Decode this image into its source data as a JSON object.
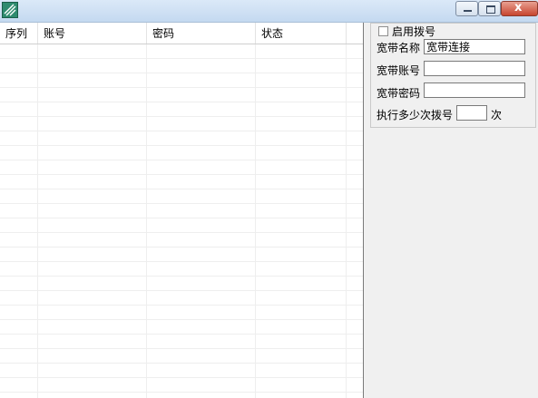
{
  "window": {
    "title": "",
    "icon": "app-logo-icon",
    "buttons": [
      "minimize-icon",
      "maximize-icon",
      "close-icon"
    ],
    "close_glyph": "x"
  },
  "grid": {
    "columns": [
      "序列",
      "账号",
      "密码",
      "状态"
    ],
    "rows": []
  },
  "settings": {
    "enable_dial_label": "启用拨号",
    "enable_dial_checked": false,
    "broadband_name_label": "宽带名称",
    "broadband_name_value": "宽带连接",
    "broadband_account_label": "宽带账号",
    "broadband_account_value": "",
    "broadband_password_label": "宽带密码",
    "broadband_password_value": "",
    "dial_times_label": "执行多少次拨号",
    "dial_times_value": "",
    "dial_times_unit": "次"
  }
}
